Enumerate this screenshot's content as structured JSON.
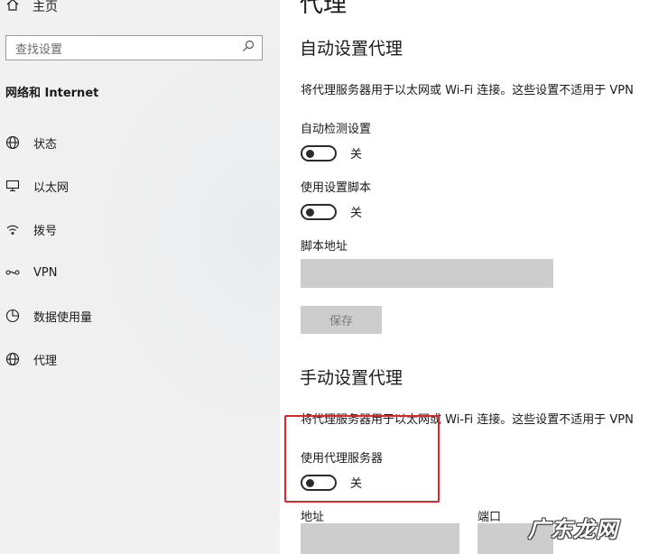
{
  "sidebar": {
    "home_label": "主页",
    "search_placeholder": "查找设置",
    "section_title": "网络和 Internet",
    "items": [
      {
        "label": "状态",
        "icon": "globe-status-icon"
      },
      {
        "label": "以太网",
        "icon": "ethernet-icon"
      },
      {
        "label": "拨号",
        "icon": "dialup-icon"
      },
      {
        "label": "VPN",
        "icon": "vpn-icon"
      },
      {
        "label": "数据使用量",
        "icon": "data-usage-icon"
      },
      {
        "label": "代理",
        "icon": "proxy-globe-icon"
      }
    ]
  },
  "main": {
    "page_title": "代理",
    "auto": {
      "heading": "自动设置代理",
      "description": "将代理服务器用于以太网或 Wi-Fi 连接。这些设置不适用于 VPN",
      "detect_label": "自动检测设置",
      "detect_state": "关",
      "script_label": "使用设置脚本",
      "script_state": "关",
      "script_address_label": "脚本地址",
      "script_address_value": "",
      "save_label": "保存"
    },
    "manual": {
      "heading": "手动设置代理",
      "description": "将代理服务器用于以太网或 Wi-Fi 连接。这些设置不适用于 VPN",
      "use_proxy_label": "使用代理服务器",
      "use_proxy_state": "关",
      "address_label": "地址",
      "address_value": "",
      "port_label": "端口",
      "port_value": ""
    }
  },
  "watermark": "广东龙网",
  "colors": {
    "highlight": "#e0262a",
    "field": "#cdcdcd"
  }
}
